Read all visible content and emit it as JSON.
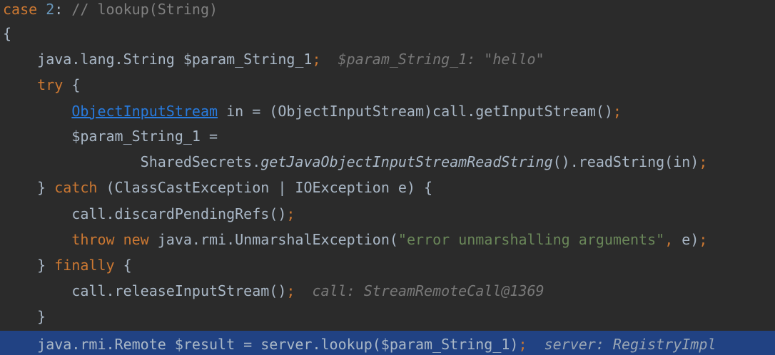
{
  "colors": {
    "background": "#2b2b2b",
    "keyword": "#cc7832",
    "number": "#6897bb",
    "comment": "#808080",
    "string": "#6a8759",
    "identifier": "#a9b7c6",
    "link": "#287bde",
    "inline_hint": "#787878",
    "current_line_highlight": "#214283"
  },
  "code": {
    "lines": [
      {
        "tokens": [
          {
            "text": "case ",
            "kind": "kw"
          },
          {
            "text": "2",
            "kind": "num"
          },
          {
            "text": ": ",
            "kind": "plain"
          },
          {
            "text": "// lookup(String)",
            "kind": "com"
          }
        ]
      },
      {
        "tokens": [
          {
            "text": "{",
            "kind": "plain"
          }
        ]
      },
      {
        "tokens": [
          {
            "text": "    java.lang.String $param_String_1",
            "kind": "plain"
          },
          {
            "text": ";",
            "kind": "kw"
          },
          {
            "text": "  $param_String_1: \"hello\"",
            "kind": "hint"
          }
        ]
      },
      {
        "tokens": [
          {
            "text": "    ",
            "kind": "plain"
          },
          {
            "text": "try",
            "kind": "kw"
          },
          {
            "text": " {",
            "kind": "plain"
          }
        ]
      },
      {
        "tokens": [
          {
            "text": "        ",
            "kind": "plain"
          },
          {
            "text": "ObjectInputStream",
            "kind": "link"
          },
          {
            "text": " in = (ObjectInputStream)call.getInputStream()",
            "kind": "plain"
          },
          {
            "text": ";",
            "kind": "kw"
          }
        ]
      },
      {
        "tokens": [
          {
            "text": "        $param_String_1 =",
            "kind": "plain"
          }
        ]
      },
      {
        "tokens": [
          {
            "text": "                SharedSecrets.",
            "kind": "plain"
          },
          {
            "text": "getJavaObjectInputStreamReadString",
            "kind": "plain italic"
          },
          {
            "text": "().readString(in)",
            "kind": "plain"
          },
          {
            "text": ";",
            "kind": "kw"
          }
        ]
      },
      {
        "tokens": [
          {
            "text": "    } ",
            "kind": "plain"
          },
          {
            "text": "catch",
            "kind": "kw"
          },
          {
            "text": " (ClassCastException | IOException e) {",
            "kind": "plain"
          }
        ]
      },
      {
        "tokens": [
          {
            "text": "        call.discardPendingRefs()",
            "kind": "plain"
          },
          {
            "text": ";",
            "kind": "kw"
          }
        ]
      },
      {
        "tokens": [
          {
            "text": "        ",
            "kind": "plain"
          },
          {
            "text": "throw new ",
            "kind": "kw"
          },
          {
            "text": "java.rmi.UnmarshalException(",
            "kind": "plain"
          },
          {
            "text": "\"error unmarshalling arguments\"",
            "kind": "str"
          },
          {
            "text": ", ",
            "kind": "kw"
          },
          {
            "text": "e)",
            "kind": "plain"
          },
          {
            "text": ";",
            "kind": "kw"
          }
        ]
      },
      {
        "tokens": [
          {
            "text": "    } ",
            "kind": "plain"
          },
          {
            "text": "finally",
            "kind": "kw"
          },
          {
            "text": " {",
            "kind": "plain"
          }
        ]
      },
      {
        "tokens": [
          {
            "text": "        call.releaseInputStream()",
            "kind": "plain"
          },
          {
            "text": ";",
            "kind": "kw"
          },
          {
            "text": "  call: StreamRemoteCall@1369",
            "kind": "hint"
          }
        ]
      },
      {
        "tokens": [
          {
            "text": "    }",
            "kind": "plain"
          }
        ]
      },
      {
        "highlighted": true,
        "tokens": [
          {
            "text": "    java.rmi.Remote $result = server.lookup($param_String_1)",
            "kind": "plain"
          },
          {
            "text": ";",
            "kind": "kw"
          },
          {
            "text": "  server: RegistryImpl",
            "kind": "hl-hint"
          }
        ]
      }
    ]
  }
}
